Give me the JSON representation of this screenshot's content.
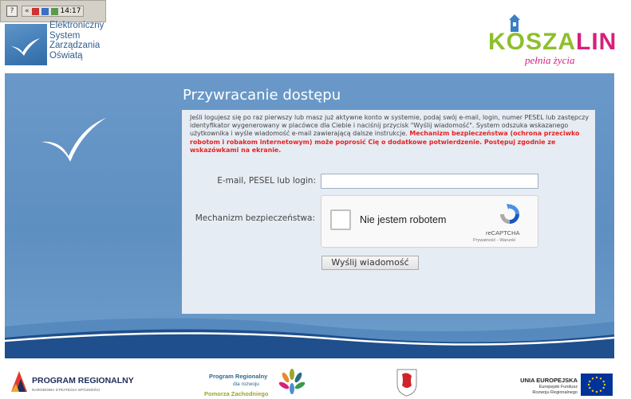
{
  "taskbar": {
    "help_icon": "?",
    "time": "14:17",
    "expand_icon": "«"
  },
  "header": {
    "system_logo": {
      "lines": [
        "Elektroniczny",
        "System",
        "Zarządzania",
        "Oświatą"
      ]
    },
    "city_logo": {
      "word_part1": "KOSZA",
      "word_part2": "LIN",
      "tagline": "pełnia życia"
    }
  },
  "form": {
    "title": "Przywracanie dostępu",
    "info_text": "Jeśli logujesz się po raz pierwszy lub masz już aktywne konto w systemie, podaj swój e-mail, login, numer PESEL lub zastępczy identyfikator wygenerowany w placówce dla Ciebie i naciśnij przycisk \"Wyślij wiadomość\". System odszuka wskazanego użytkownika i wyśle wiadomość e-mail zawierającą dalsze instrukcje.",
    "warning_text": "Mechanizm bezpieczeństwa (ochrona przeciwko robotom i robakom internetowym) może poprosić Cię o dodatkowe potwierdzenie. Postępuj zgodnie ze wskazówkami na ekranie.",
    "login_label": "E-mail, PESEL lub login:",
    "login_value": "",
    "security_label": "Mechanizm bezpieczeństwa:",
    "captcha": {
      "checkbox_label": "Nie jestem robotem",
      "brand": "reCAPTCHA",
      "links": "Prywatność - Warunki"
    },
    "submit_label": "Wyślij wiadomość"
  },
  "footer": {
    "program_regionalny": {
      "title": "PROGRAM REGIONALNY",
      "subtitle": "NARODOWA STRATEGIA SPÓJNOŚCI"
    },
    "pomorze": {
      "line1": "Program Regionalny",
      "line2": "dla rozwoju",
      "line3": "Pomorza Zachodniego"
    },
    "eu": {
      "title": "UNIA EUROPEJSKA",
      "line1": "Europejski Fundusz",
      "line2": "Rozwoju Regionalnego"
    }
  },
  "colors": {
    "band": "#6a99c9",
    "panel": "#e6ecf3",
    "warning": "#e52222",
    "brand_green": "#8dbf2b",
    "brand_pink": "#d5217a"
  }
}
